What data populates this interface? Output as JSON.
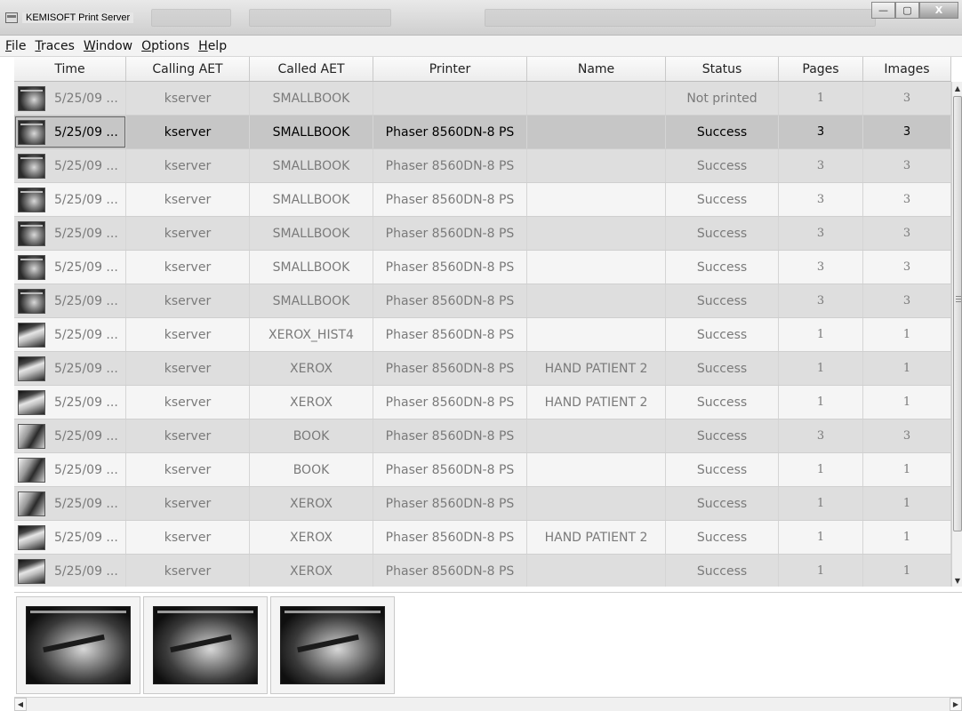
{
  "window": {
    "title": "KEMISOFT Print Server",
    "minimize": "—",
    "maximize": "▢",
    "close": "X"
  },
  "menu": [
    {
      "mnemonic": "F",
      "rest": "ile"
    },
    {
      "mnemonic": "T",
      "rest": "races"
    },
    {
      "mnemonic": "W",
      "rest": "indow"
    },
    {
      "mnemonic": "O",
      "rest": "ptions"
    },
    {
      "mnemonic": "H",
      "rest": "elp"
    }
  ],
  "table": {
    "columns": [
      "Time",
      "Calling AET",
      "Called AET",
      "Printer",
      "Name",
      "Status",
      "Pages",
      "Images"
    ],
    "rows": [
      {
        "thumb": "ultrasound-thumbnail-icon",
        "time": "5/25/09 ...",
        "calling": "kserver",
        "called": "SMALLBOOK",
        "printer": "",
        "name": "",
        "status": "Not printed",
        "pages": "1",
        "images": "3"
      },
      {
        "thumb": "ultrasound-thumbnail-icon",
        "time": "5/25/09 ...",
        "calling": "kserver",
        "called": "SMALLBOOK",
        "printer": "Phaser 8560DN-8 PS",
        "name": "",
        "status": "Success",
        "pages": "3",
        "images": "3"
      },
      {
        "thumb": "ultrasound-thumbnail-icon",
        "time": "5/25/09 ...",
        "calling": "kserver",
        "called": "SMALLBOOK",
        "printer": "Phaser 8560DN-8 PS",
        "name": "",
        "status": "Success",
        "pages": "3",
        "images": "3"
      },
      {
        "thumb": "ultrasound-thumbnail-icon",
        "time": "5/25/09 ...",
        "calling": "kserver",
        "called": "SMALLBOOK",
        "printer": "Phaser 8560DN-8 PS",
        "name": "",
        "status": "Success",
        "pages": "3",
        "images": "3"
      },
      {
        "thumb": "ultrasound-thumbnail-icon",
        "time": "5/25/09 ...",
        "calling": "kserver",
        "called": "SMALLBOOK",
        "printer": "Phaser 8560DN-8 PS",
        "name": "",
        "status": "Success",
        "pages": "3",
        "images": "3"
      },
      {
        "thumb": "ultrasound-thumbnail-icon",
        "time": "5/25/09 ...",
        "calling": "kserver",
        "called": "SMALLBOOK",
        "printer": "Phaser 8560DN-8 PS",
        "name": "",
        "status": "Success",
        "pages": "3",
        "images": "3"
      },
      {
        "thumb": "ultrasound-thumbnail-icon",
        "time": "5/25/09 ...",
        "calling": "kserver",
        "called": "SMALLBOOK",
        "printer": "Phaser 8560DN-8 PS",
        "name": "",
        "status": "Success",
        "pages": "3",
        "images": "3"
      },
      {
        "thumb": "xray-thumbnail-icon",
        "time": "5/25/09 ...",
        "calling": "kserver",
        "called": "XEROX_HIST4",
        "printer": "Phaser 8560DN-8 PS",
        "name": "",
        "status": "Success",
        "pages": "1",
        "images": "1"
      },
      {
        "thumb": "xray-thumbnail-icon",
        "time": "5/25/09 ...",
        "calling": "kserver",
        "called": "XEROX",
        "printer": "Phaser 8560DN-8 PS",
        "name": "HAND PATIENT 2",
        "status": "Success",
        "pages": "1",
        "images": "1"
      },
      {
        "thumb": "xray-thumbnail-icon",
        "time": "5/25/09 ...",
        "calling": "kserver",
        "called": "XEROX",
        "printer": "Phaser 8560DN-8 PS",
        "name": "HAND PATIENT 2",
        "status": "Success",
        "pages": "1",
        "images": "1"
      },
      {
        "thumb": "book-thumbnail-icon",
        "time": "5/25/09 ...",
        "calling": "kserver",
        "called": "BOOK",
        "printer": "Phaser 8560DN-8 PS",
        "name": "",
        "status": "Success",
        "pages": "3",
        "images": "3"
      },
      {
        "thumb": "book-thumbnail-icon",
        "time": "5/25/09 ...",
        "calling": "kserver",
        "called": "BOOK",
        "printer": "Phaser 8560DN-8 PS",
        "name": "",
        "status": "Success",
        "pages": "1",
        "images": "1"
      },
      {
        "thumb": "book-thumbnail-icon",
        "time": "5/25/09 ...",
        "calling": "kserver",
        "called": "XEROX",
        "printer": "Phaser 8560DN-8 PS",
        "name": "",
        "status": "Success",
        "pages": "1",
        "images": "1"
      },
      {
        "thumb": "xray-thumbnail-icon",
        "time": "5/25/09 ...",
        "calling": "kserver",
        "called": "XEROX",
        "printer": "Phaser 8560DN-8 PS",
        "name": "HAND PATIENT 2",
        "status": "Success",
        "pages": "1",
        "images": "1"
      },
      {
        "thumb": "xray-thumbnail-icon",
        "time": "5/25/09 ...",
        "calling": "kserver",
        "called": "XEROX",
        "printer": "Phaser 8560DN-8 PS",
        "name": "",
        "status": "Success",
        "pages": "1",
        "images": "1"
      }
    ]
  },
  "preview": {
    "images": [
      "ultrasound-preview-image",
      "ultrasound-preview-image",
      "ultrasound-preview-image"
    ]
  },
  "scroll": {
    "up": "▲",
    "down": "▼",
    "left": "◀",
    "right": "▶"
  }
}
